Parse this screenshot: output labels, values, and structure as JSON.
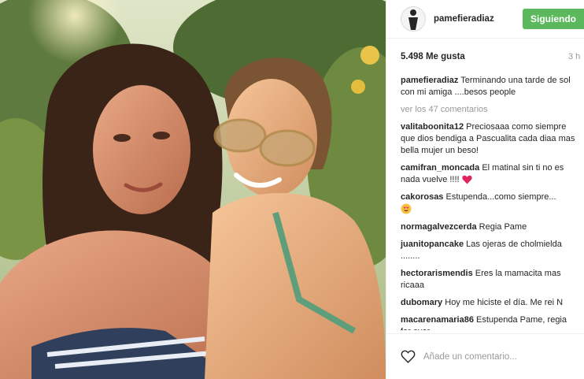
{
  "post": {
    "image_alt": "selfie",
    "header": {
      "username": "pamefieradiaz",
      "follow_label": "Siguiendo",
      "follow_color": "#5cb85c"
    },
    "likes": "5.498 Me gusta",
    "time": "3 h",
    "caption": {
      "user": "pamefieradiaz",
      "text": "Terminando una tarde de sol con mi amiga ....besos people"
    },
    "view_all": "ver los 47 comentarios",
    "comments": [
      {
        "user": "valitaboonita12",
        "text": "Preciosaaa como siempre que dios bendiga a Pascualita cada diaa mas bella mujer un beso!"
      },
      {
        "user": "camifran_moncada",
        "text": "El matinal sin ti no es nada vuelve !!!!",
        "emoji": "heart-emoji"
      },
      {
        "user": "cakorosas",
        "text": "Estupenda...como siempre...",
        "emoji": "heart-eyes-emoji"
      },
      {
        "user": "normagalvezcerda",
        "text": "Regia Pame"
      },
      {
        "user": "juanitopancake",
        "text": "Las ojeras de cholmielda ........"
      },
      {
        "user": "hectorarismendis",
        "text": "Eres la mamacita mas ricaaa"
      },
      {
        "user": "dubomary",
        "text": "Hoy me hiciste el día. Me rei N"
      },
      {
        "user": "macarenamaria86",
        "text": "Estupenda Pame, regia for ever"
      }
    ],
    "comment_placeholder": "Añade un comentario..."
  }
}
